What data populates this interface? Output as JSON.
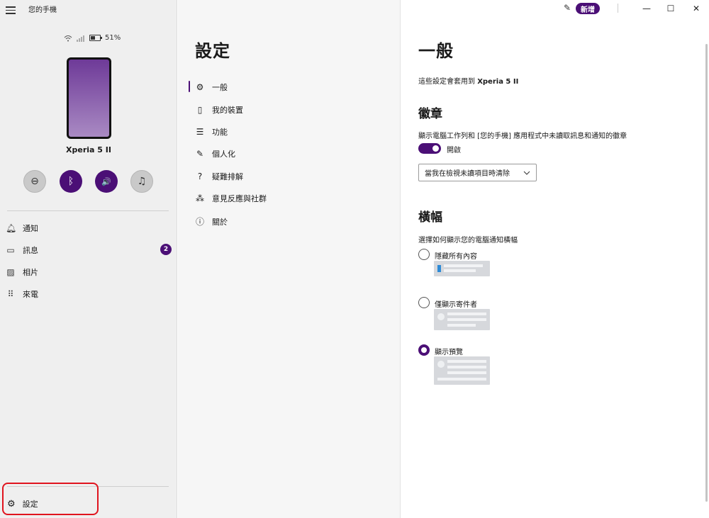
{
  "app": {
    "title": "您的手機"
  },
  "phone": {
    "battery": "51%",
    "device_name": "Xperia 5 II"
  },
  "quick_actions": [
    {
      "name": "do-not-disturb",
      "glyph": "⊖",
      "active": false
    },
    {
      "name": "bluetooth",
      "glyph": "ᛒ",
      "active": true
    },
    {
      "name": "volume",
      "glyph": "🔊",
      "active": true
    },
    {
      "name": "media",
      "glyph": "♫",
      "active": false
    }
  ],
  "sidebar": {
    "items": [
      {
        "label": "通知",
        "icon": "bell-icon"
      },
      {
        "label": "訊息",
        "icon": "message-icon",
        "badge": "2"
      },
      {
        "label": "相片",
        "icon": "photo-icon"
      },
      {
        "label": "來電",
        "icon": "dialpad-icon"
      }
    ],
    "settings_label": "設定"
  },
  "settings_menu": {
    "title": "設定",
    "items": [
      {
        "label": "一般",
        "icon": "gear-icon",
        "selected": true
      },
      {
        "label": "我的裝置",
        "icon": "phone-icon"
      },
      {
        "label": "功能",
        "icon": "list-icon"
      },
      {
        "label": "個人化",
        "icon": "personalize-icon"
      },
      {
        "label": "疑難排解",
        "icon": "troubleshoot-icon"
      },
      {
        "label": "意見反應與社群",
        "icon": "community-icon"
      },
      {
        "label": "關於",
        "icon": "info-icon"
      }
    ]
  },
  "titlebar": {
    "new_label": "新增",
    "minimize": "—",
    "maximize": "☐",
    "close": "✕"
  },
  "general": {
    "title": "一般",
    "note_prefix": "這些設定會套用到 ",
    "note_device": "Xperia 5 II",
    "badges": {
      "heading": "徽章",
      "description": "顯示電腦工作列和 [您的手機] 應用程式中未讀取訊息和通知的徽章",
      "toggle_label": "開啟",
      "toggle_on": true,
      "dropdown_value": "當我在檢視未讀項目時清除"
    },
    "banners": {
      "heading": "橫幅",
      "description": "選擇如何顯示您的電腦通知橫幅",
      "options": [
        {
          "label": "隱藏所有內容",
          "checked": false
        },
        {
          "label": "僅顯示寄件者",
          "checked": false
        },
        {
          "label": "顯示預覽",
          "checked": true
        }
      ]
    }
  },
  "colors": {
    "accent": "#4b0f76",
    "highlight_border": "#e0141e"
  }
}
